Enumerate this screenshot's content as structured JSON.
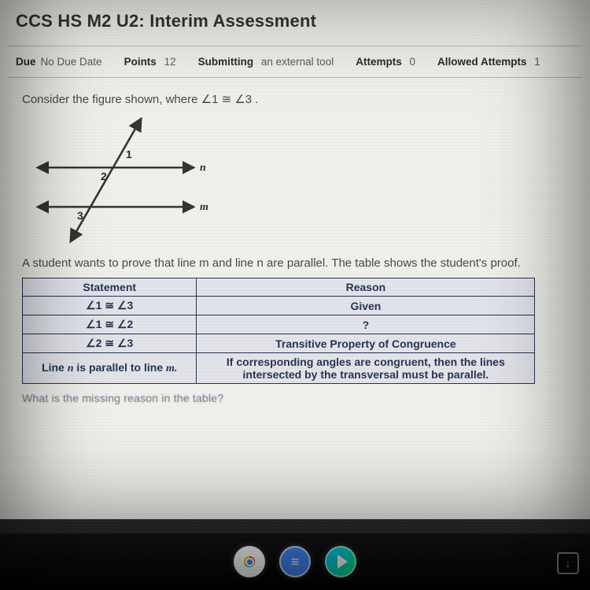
{
  "page": {
    "title": "CCS HS M2 U2: Interim Assessment"
  },
  "meta": {
    "due_k": "Due",
    "due_v": "No Due Date",
    "points_k": "Points",
    "points_v": "12",
    "submitting_k": "Submitting",
    "submitting_v": "an external tool",
    "attempts_k": "Attempts",
    "attempts_v": "0",
    "allowed_k": "Allowed Attempts",
    "allowed_v": "1"
  },
  "question": {
    "prompt_pre": "Consider the figure shown, where ",
    "prompt_rel": "∠1  ≅  ∠3 .",
    "below": "A student wants to prove that line m and line n are parallel. The table shows the student's proof."
  },
  "figure": {
    "label_1": "1",
    "label_2": "2",
    "label_3": "3",
    "line_n": "n",
    "line_m": "m"
  },
  "table": {
    "h1": "Statement",
    "h2": "Reason",
    "r1s": "∠1 ≅ ∠3",
    "r1r": "Given",
    "r2s": "∠1 ≅ ∠2",
    "r2r": "?",
    "r3s": "∠2 ≅ ∠3",
    "r3r": "Transitive Property of Congruence",
    "r4s_pre": "Line ",
    "r4s_n": "n",
    "r4s_mid": " is parallel to line ",
    "r4s_m": "m.",
    "r4r": "If corresponding angles are congruent, then the lines intersected by the transversal must be parallel."
  },
  "cutoff": "What is the missing reason in the table?",
  "taskbar": {
    "chrome": "chrome-icon",
    "docs_glyph": "≡",
    "play": "play-icon"
  }
}
